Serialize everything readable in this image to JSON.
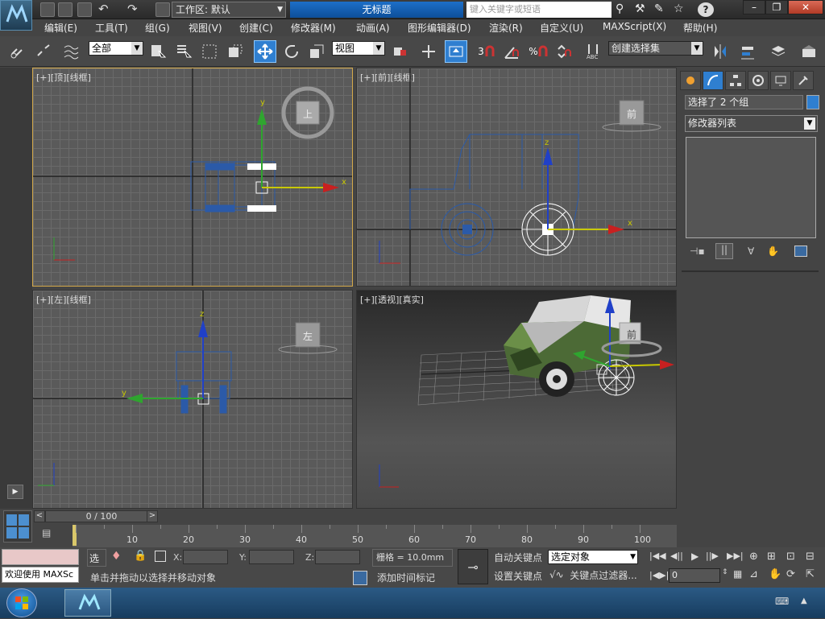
{
  "title_bar": {
    "workspace_label": "工作区: 默认",
    "window_title": "无标题",
    "search_placeholder": "键入关键字或短语"
  },
  "menu": [
    "编辑(E)",
    "工具(T)",
    "组(G)",
    "视图(V)",
    "创建(C)",
    "修改器(M)",
    "动画(A)",
    "图形编辑器(D)",
    "渲染(R)",
    "自定义(U)",
    "MAXScript(X)",
    "帮助(H)"
  ],
  "toolbar": {
    "filter_value": "全部",
    "ref_coord_value": "视图",
    "selection_set_value": "创建选择集",
    "snap_3": "3",
    "percent": "%"
  },
  "viewports": {
    "top": {
      "label": "[+][顶][线框]",
      "cube": "上"
    },
    "front": {
      "label": "[+][前][线框]",
      "cube": "前"
    },
    "left": {
      "label": "[+][左][线框]",
      "cube": "左"
    },
    "persp": {
      "label": "[+][透视][真实]",
      "cube": "前"
    }
  },
  "command_panel": {
    "selection_text": "选择了 2 个组",
    "modifier_list": "修改器列表",
    "accent_color": "#2f7fd0"
  },
  "timeline": {
    "slider_text": "0 / 100",
    "ticks": [
      "10",
      "20",
      "30",
      "40",
      "50",
      "60",
      "70",
      "80",
      "90",
      "100"
    ]
  },
  "status": {
    "maxscript_prompt": "欢迎使用 MAXSc",
    "status_line": "单击并拖动以选择并移动对象",
    "selection_label": "选择",
    "x_label": "X:",
    "y_label": "Y:",
    "z_label": "Z:",
    "grid_text": "栅格 = 10.0mm",
    "add_time_tag": "添加时间标记",
    "auto_key": "自动关键点",
    "set_key": "设置关键点",
    "key_mode_value": "选定对象",
    "key_filters": "关键点过滤器...",
    "frame_value": "0"
  }
}
